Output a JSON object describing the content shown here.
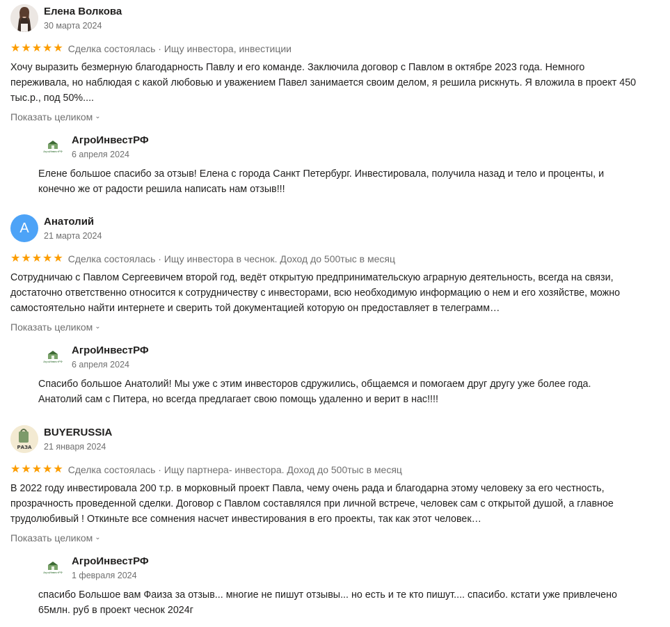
{
  "reviews": [
    {
      "author": "Елена Волкова",
      "date": "30 марта 2024",
      "avatar": {
        "type": "photo"
      },
      "stars": "★★★★★",
      "rating": 5,
      "meta": "Сделка состоялась · Ищу инвестора, инвестиции",
      "text": "Хочу выразить безмерную благодарность Павлу и его команде. Заключила договор с Павлом в октябре 2023 года. Немного переживала, но наблюдая с какой любовью и уважением Павел занимается своим делом, я решила рискнуть. Я вложила в проект 450 тыс.р., под 50%....",
      "show_more": "Показать целиком",
      "reply": {
        "author": "АгроИнвестРФ",
        "date": "6 апреля 2024",
        "logo_text": "АгроИнвестРФ",
        "text": "Елене большое спасибо за отзыв! Елена с города Санкт Петербург. Инвестировала, получила назад и тело и проценты, и конечно же от радости решила написать нам отзыв!!!"
      }
    },
    {
      "author": "Анатолий",
      "date": "21 марта 2024",
      "avatar": {
        "type": "letter",
        "letter": "А",
        "color": "#4da3f7"
      },
      "stars": "★★★★★",
      "rating": 5,
      "meta": "Сделка состоялась · Ищу инвестора в чеснок. Доход до 500тыс в месяц",
      "text": "Сотрудничаю с Павлом Сергеевичем второй год, ведёт открытую предпринимательскую аграрную деятельность, всегда на связи, достаточно ответственно относится к сотрудничеству с инвесторами, всю необходимую информацию о нем и его хозяйстве, можно самостоятельно найти интернете и сверить той документацией которую он предоставляет в телеграмм…",
      "show_more": "Показать целиком",
      "reply": {
        "author": "АгроИнвестРФ",
        "date": "6 апреля 2024",
        "logo_text": "АгроИнвестРФ",
        "text": "Спасибо большое Анатолий! Мы уже с этим инвесторов сдружились, общаемся и помогаем друг другу уже более года. Анатолий сам с Питера, но всегда предлагает свою помощь удаленно и верит в нас!!!!"
      }
    },
    {
      "author": "BUYERUSSIA",
      "date": "21 января 2024",
      "avatar": {
        "type": "logo",
        "text": "РАЗА"
      },
      "stars": "★★★★★",
      "rating": 5,
      "meta": "Сделка состоялась · Ищу партнера- инвестора. Доход до 500тыс в месяц",
      "text": "В 2022 году инвестировала 200 т.р. в морковный проект Павла, чему очень рада и благодарна этому человеку за его честность, прозрачность проведенной сделки. Договор с Павлом составлялся при личной встрече, человек сам с открытой душой, а главное трудолюбивый ! Откиньте все сомнения насчет инвестирования в его проекты, так как этот человек…",
      "show_more": "Показать целиком",
      "reply": {
        "author": "АгроИнвестРФ",
        "date": "1 февраля 2024",
        "logo_text": "АгроИнвестРФ",
        "text": "спасибо Большое вам Фаиза за отзыв... многие не пишут отзывы... но есть и те кто пишут.... спасибо. кстати уже привлечено 65млн. руб в проект чеснок 2024г"
      }
    }
  ],
  "colors": {
    "stars": "#fc9d00",
    "muted_text": "#6f6f6f",
    "main_text": "#21201f",
    "avatar_letter_bg": "#4da3f7"
  }
}
